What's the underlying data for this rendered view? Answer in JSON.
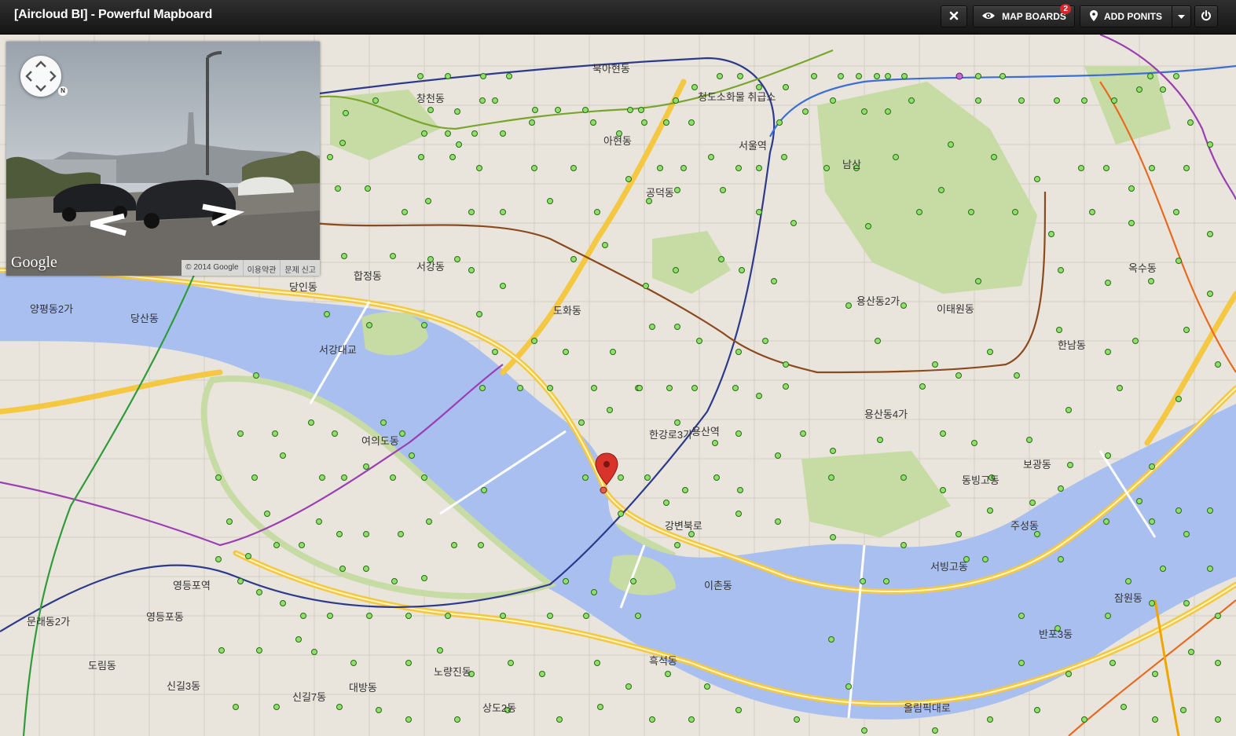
{
  "app": {
    "title": "[Aircloud BI] - Powerful Mapboard"
  },
  "toolbar": {
    "close_icon": "times-icon",
    "map_boards_label": "MAP BOARDS",
    "map_boards_count": "2",
    "add_points_label": "ADD PONITS",
    "power_icon": "power-icon"
  },
  "street_view": {
    "logo": "Google",
    "copyright": "© 2014 Google",
    "terms": "이용약관",
    "report": "문제 신고"
  },
  "map": {
    "marker_color": "#d9342b",
    "point_color": "#7fd35d",
    "labels": [
      {
        "text": "서강대교"
      },
      {
        "text": "청도소화물 취급소"
      },
      {
        "text": "남산"
      },
      {
        "text": "서울역"
      },
      {
        "text": "용산역"
      },
      {
        "text": "영등포역"
      },
      {
        "text": "용산동4가"
      },
      {
        "text": "한강로3가"
      },
      {
        "text": "여의도동"
      },
      {
        "text": "올림픽대로"
      },
      {
        "text": "강변북로"
      },
      {
        "text": "이촌동"
      },
      {
        "text": "서빙고동"
      },
      {
        "text": "반포3동"
      },
      {
        "text": "흑석동"
      },
      {
        "text": "노량진동"
      },
      {
        "text": "신길7동"
      },
      {
        "text": "대방동"
      },
      {
        "text": "당산동"
      },
      {
        "text": "문래동2가"
      },
      {
        "text": "보광동"
      },
      {
        "text": "한남동"
      },
      {
        "text": "이태원동"
      },
      {
        "text": "용산동2가"
      },
      {
        "text": "도화동"
      },
      {
        "text": "공덕동"
      },
      {
        "text": "아현동"
      },
      {
        "text": "북아현동"
      },
      {
        "text": "창천동"
      },
      {
        "text": "서강동"
      },
      {
        "text": "합정동"
      },
      {
        "text": "당인동"
      },
      {
        "text": "양평동2가"
      },
      {
        "text": "영등포동"
      },
      {
        "text": "도림동"
      },
      {
        "text": "신길3동"
      },
      {
        "text": "상도2동"
      },
      {
        "text": "주성동"
      },
      {
        "text": "동빙고동"
      },
      {
        "text": "잠원동"
      },
      {
        "text": "옥수동"
      }
    ]
  }
}
